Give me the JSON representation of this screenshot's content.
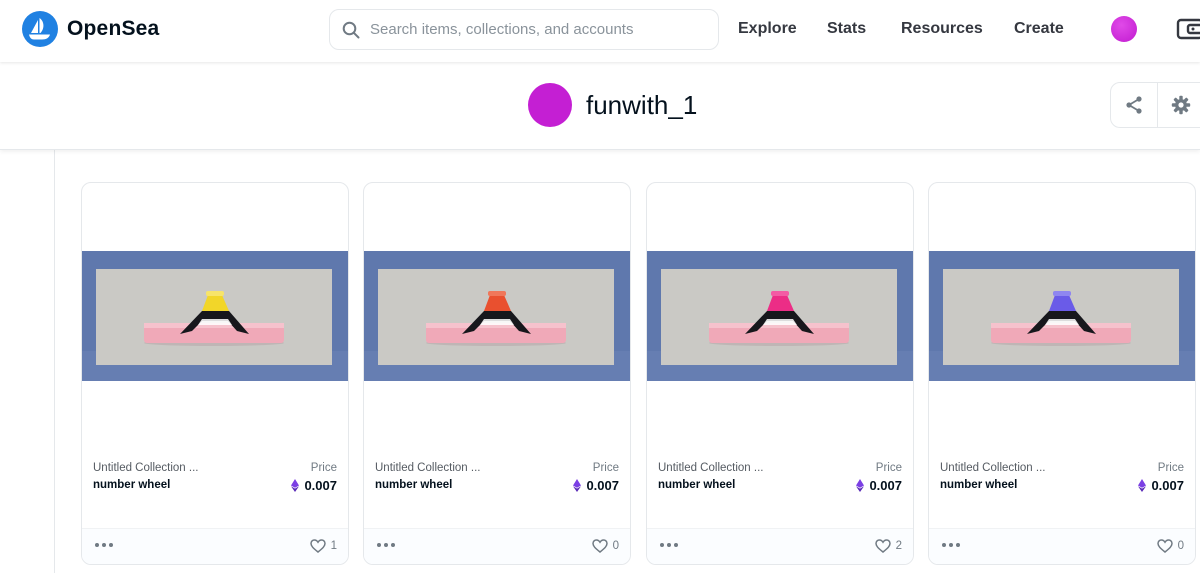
{
  "header": {
    "brand": "OpenSea",
    "search_placeholder": "Search items, collections, and accounts",
    "nav": [
      "Explore",
      "Stats",
      "Resources",
      "Create"
    ]
  },
  "profile": {
    "username": "funwith_1",
    "avatar_color": "#c41fd3"
  },
  "colors": {
    "brand_blue": "#2081e2",
    "eth_purple": "#7b3fe4"
  },
  "cards": [
    {
      "collection": "Untitled Collection ...",
      "name": "number wheel",
      "price_label": "Price",
      "price": "0.007",
      "likes": "1",
      "accent": "#f2d629"
    },
    {
      "collection": "Untitled Collection ...",
      "name": "number wheel",
      "price_label": "Price",
      "price": "0.007",
      "likes": "0",
      "accent": "#e9502f"
    },
    {
      "collection": "Untitled Collection ...",
      "name": "number wheel",
      "price_label": "Price",
      "price": "0.007",
      "likes": "2",
      "accent": "#ec2d86"
    },
    {
      "collection": "Untitled Collection ...",
      "name": "number wheel",
      "price_label": "Price",
      "price": "0.007",
      "likes": "0",
      "accent": "#6a5be8"
    }
  ]
}
